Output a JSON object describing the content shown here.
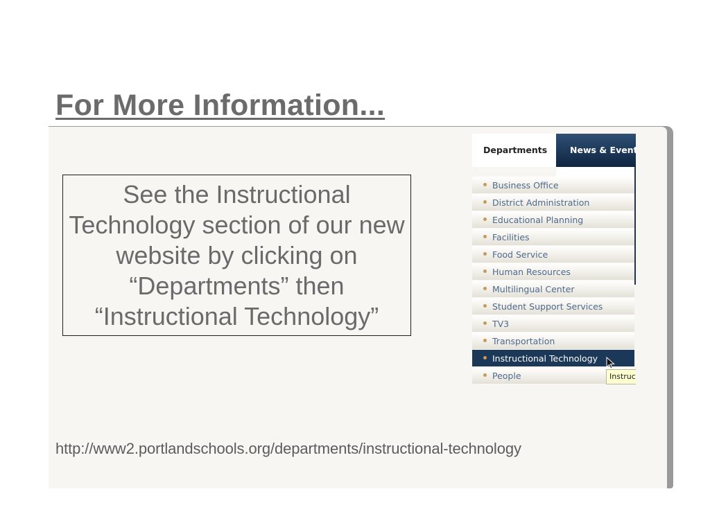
{
  "slide": {
    "title": "For More Information...",
    "info_box_text": "See the Instructional Technology section of our new website by clicking on “Departments” then “Instructional Technology”",
    "url": "http://www2.portlandschools.org/departments/instructional-technology"
  },
  "website": {
    "tabs": [
      {
        "label": "Departments",
        "active": true
      },
      {
        "label": "News & Events",
        "active": false
      }
    ],
    "menu_items": [
      {
        "label": "Business Office"
      },
      {
        "label": "District Administration"
      },
      {
        "label": "Educational Planning"
      },
      {
        "label": "Facilities"
      },
      {
        "label": "Food Service"
      },
      {
        "label": "Human Resources"
      },
      {
        "label": "Multilingual Center"
      },
      {
        "label": "Student Support Services"
      },
      {
        "label": "TV3"
      },
      {
        "label": "Transportation"
      },
      {
        "label": "Instructional Technology",
        "active": true
      },
      {
        "label": "People"
      }
    ],
    "tooltip": "Instruct",
    "cursor_icon": "mouse-pointer-icon"
  },
  "colors": {
    "title_gray": "#6b6b6b",
    "panel_bg": "#f7f6f3",
    "nav_blue": "#1c3859",
    "link_blue": "#4e6a8c",
    "bullet_tan": "#c69a5a",
    "tooltip_bg": "#fefed0"
  }
}
